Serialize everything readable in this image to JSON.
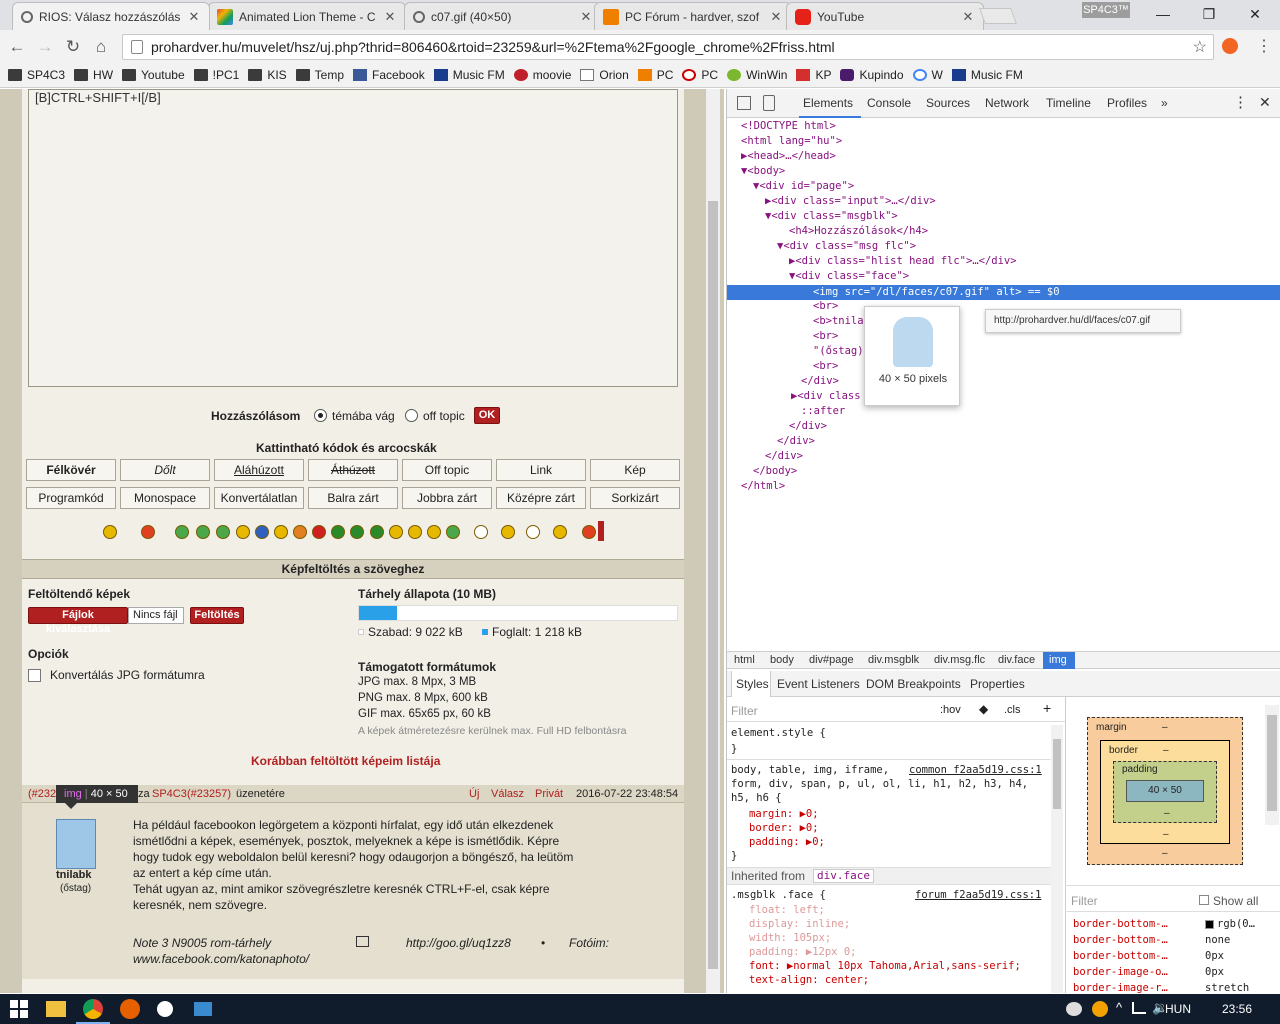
{
  "browser": {
    "tabs": [
      {
        "title": "RIOS: Válasz hozzászólás",
        "active": true
      },
      {
        "title": "Animated Lion Theme - C"
      },
      {
        "title": "c07.gif (40×50)"
      },
      {
        "title": "PC Fórum - hardver, szof"
      },
      {
        "title": "YouTube"
      }
    ],
    "profile": "SP4C3™",
    "url": "prohardver.hu/muvelet/hsz/uj.php?thrid=806460&rtoid=23259&url=%2Ftema%2Fgoogle_chrome%2Ffriss.html",
    "bookmarks": [
      "SP4C3",
      "HW",
      "Youtube",
      "!PC1",
      "KIS",
      "Temp",
      "Facebook",
      "Music FM",
      "moovie",
      "Orion",
      "PC",
      "PC",
      "WinWin",
      "KP",
      "Kupindo",
      "W",
      "Music FM"
    ]
  },
  "page": {
    "editor_text": "[B]CTRL+SHIFT+I[/B]",
    "post_as_label": "Hozzászólásom",
    "radio_topic": "témába vág",
    "radio_offtopic": "off topic",
    "ok": "OK",
    "codes_title": "Kattintható kódok és arcocskák",
    "code_buttons_row1": [
      "Félkövér",
      "Dőlt",
      "Aláhúzott",
      "Áthúzott",
      "Off topic",
      "Link",
      "Kép"
    ],
    "code_buttons_row2": [
      "Programkód",
      "Monospace",
      "Konvertálatlan",
      "Balra zárt",
      "Jobbra zárt",
      "Középre zárt",
      "Sorkizárt"
    ],
    "upload_title": "Képfeltöltés a szöveghez",
    "upload_images_label": "Feltöltendő képek",
    "choose_files": "Fájlok kiválasztása",
    "no_file": "Nincs fájl",
    "upload_btn": "Feltöltés",
    "options_label": "Opciók",
    "convert_jpg": "Konvertálás JPG formátumra",
    "storage_label": "Tárhely állapota (10 MB)",
    "storage_used_fraction": 0.12,
    "storage_free": "Szabad: 9 022 kB",
    "storage_used": "Foglalt: 1 218 kB",
    "formats_label": "Támogatott formátumok",
    "format_jpg": "JPG max. 8 Mpx, 3 MB",
    "format_png": "PNG max. 8 Mpx, 600 kB",
    "format_gif": "GIF max. 65x65 px, 60 kB",
    "resize_note": "A képek átméretezésre kerülnek max. Full HD felbontásra",
    "previous_uploads": "Korábban feltöltött képeim listája",
    "post": {
      "ref_prefix": "(#232",
      "ref_middle": "za",
      "author_link": "SP4C3",
      "author_ref": "(#23257)",
      "suffix": "üzenetére",
      "actions": [
        "Új",
        "Válasz",
        "Privát"
      ],
      "datetime": "2016-07-22 23:48:54",
      "user": "tnilabk",
      "rank": "(őstag)",
      "body_lines": [
        "Ha például facebookon legörgetem a központi hírfalat, egy idő után elkezdenek",
        "ismétlődni a képek, események, posztok, melyeknek a képe is ismétlődik. Képre",
        "hogy tudok egy weboldalon belül keresni? hogy odaugorjon a böngésző, ha leütöm",
        "az entert a kép címe után.",
        "Tehát ugyan az, mint amikor szövegrészletre keresnék CTRL+F-el, csak képre",
        "keresnék, nem szövegre."
      ],
      "sig_line1_left": "Note 3 N9005 rom-tárhely",
      "sig_line1_link": "http://goo.gl/uq1zz8",
      "sig_line1_right": "Fotóim:",
      "sig_line2": "www.facebook.com/katonaphoto/"
    },
    "tooltip_tag": "img",
    "tooltip_size": "40 × 50"
  },
  "devtools": {
    "tabs": [
      "Elements",
      "Console",
      "Sources",
      "Network",
      "Timeline",
      "Profiles"
    ],
    "preview_size": "40 × 50 pixels",
    "url_tooltip": "http://prohardver.hu/dl/faces/c07.gif",
    "dom_lines": [
      "<!DOCTYPE html>",
      "<html lang=\"hu\">",
      "▶<head>…</head>",
      "▼<body>",
      "▼<div id=\"page\">",
      "▶<div class=\"input\">…</div>",
      "▼<div class=\"msgblk\">",
      "<h4>Hozzászólások</h4>",
      "▼<div class=\"msg flc\">",
      "▶<div class=\"hlist head flc\">…</div>",
      "▼<div class=\"face\">",
      "<img src=\"/dl/faces/c07.gif\" alt> == $0",
      "<br>",
      "<b>tnila",
      "<br>",
      "\"(őstag)",
      "<br>",
      "</div>",
      "▶<div class",
      "::after",
      "</div>",
      "</div>",
      "</div>",
      "</body>",
      "</html>"
    ],
    "crumbs": [
      "html",
      "body",
      "div#page",
      "div.msgblk",
      "div.msg.flc",
      "div.face",
      "img"
    ],
    "subtabs": [
      "Styles",
      "Event Listeners",
      "DOM Breakpoints",
      "Properties"
    ],
    "filter": "Filter",
    "hov": ":hov",
    "cls": ".cls",
    "element_style": "element.style {",
    "close_brace": "}",
    "rule1_selector_1": "body, table, img, iframe,",
    "rule1_selector_2": "form, div, span, p, ul, ol, li, h1, h2, h3, h4,",
    "rule1_selector_3": "h5, h6 {",
    "rule1_source": "common f2aa5d19.css:1",
    "rule1_props": [
      "margin: ▶0;",
      "border: ▶0;",
      "padding: ▶0;"
    ],
    "inherited_label": "Inherited from",
    "inherited_from": "div.face",
    "rule2_selector": ".msgblk .face {",
    "rule2_source": "forum f2aa5d19.css:1",
    "rule2_props": [
      "float: left;",
      "display: inline;",
      "width: 105px;",
      "padding: ▶12px 0;",
      "font: ▶normal 10px Tahoma,Arial,sans-serif;",
      "text-align: center;"
    ],
    "box_margin": "margin",
    "box_border": "border",
    "box_padding": "padding",
    "box_content": "40 × 50",
    "dash": "–",
    "filter2": "Filter",
    "show_all": "Show all",
    "computed": [
      {
        "prop": "border-bottom-…",
        "val": "rgb(0…"
      },
      {
        "prop": "border-bottom-…",
        "val": "none"
      },
      {
        "prop": "border-bottom-…",
        "val": "0px"
      },
      {
        "prop": "border-image-o…",
        "val": "0px"
      },
      {
        "prop": "border-image-r…",
        "val": "stretch"
      }
    ]
  },
  "taskbar": {
    "lang": "HUN",
    "time": "23:56"
  },
  "colors": {
    "accent_select": "#3879d9",
    "ph_red": "#b02020",
    "link_red": "#b02020"
  }
}
